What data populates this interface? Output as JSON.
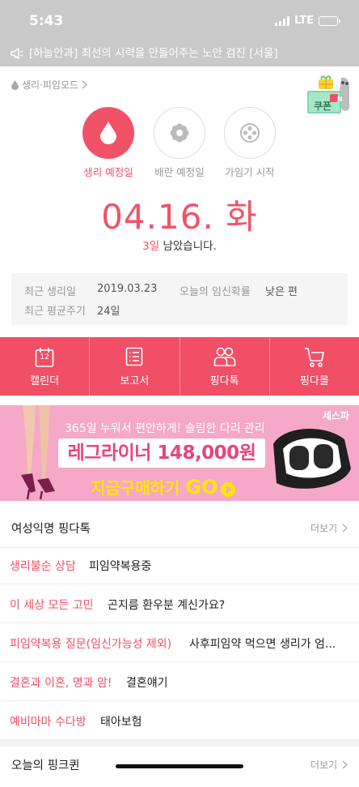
{
  "status_bar": {
    "time": "5:43",
    "network": "LTE",
    "battery_level": 0.7
  },
  "notice": {
    "text": "[하늘안과] 최선의 시력을 만들어주는 노안 검진 [서울]"
  },
  "mode": {
    "label": "생리·피임모드"
  },
  "coupon": {
    "label": "쿠폰",
    "badge": "N"
  },
  "circles": [
    {
      "label": "생리 예정일",
      "icon": "drop-icon",
      "active": true
    },
    {
      "label": "배란 예정일",
      "icon": "flower-icon",
      "active": false
    },
    {
      "label": "가임기 시작",
      "icon": "dots-ring-icon",
      "active": false
    }
  ],
  "date": {
    "value": "04.16. 화"
  },
  "remaining": {
    "days": "3일",
    "suffix": " 남았습니다."
  },
  "info": {
    "recent_period_label": "최근 생리일",
    "recent_period_value": "2019.03.23",
    "pregnancy_label": "오늘의 임신확률",
    "pregnancy_value": "낮은 편",
    "avg_cycle_label": "최근 평균주기",
    "avg_cycle_value": "24일"
  },
  "tabs": [
    {
      "label": "캘린더",
      "icon": "calendar-icon",
      "icon_text": "12"
    },
    {
      "label": "보고서",
      "icon": "report-icon"
    },
    {
      "label": "핑다톡",
      "icon": "people-icon"
    },
    {
      "label": "핑다몰",
      "icon": "cart-icon"
    }
  ],
  "banner": {
    "brand": "세스파",
    "slogan": "365일 누워서 편안하게! 슬림한 다리 관리",
    "product": "레그라이너 148,000원",
    "cta": "지금구매하기",
    "cta_go": "GO"
  },
  "community": {
    "title": "여성익명 핑다톡",
    "more": "더보기",
    "rows": [
      {
        "category": "생리불순 상담",
        "text": "피임약복용중"
      },
      {
        "category": "이 세상 모든 고민",
        "text": "곤지름 환우분 계신가요?"
      },
      {
        "category": "피임약복용 질문(임신가능성 제외)",
        "text": "사후피임약 먹으면 생리가 엄..."
      },
      {
        "category": "결혼과 이혼, 명과 암!",
        "text": "결혼얘기"
      },
      {
        "category": "예비마마 수다방",
        "text": "태아보험"
      }
    ]
  },
  "quiz": {
    "title": "오늘의 핑크퀸",
    "more": "더보기"
  },
  "colors": {
    "accent": "#f04f66",
    "status_bg": "#c9c9c9",
    "banner_bg": "#f5a8c8",
    "cta": "#ffe600"
  }
}
